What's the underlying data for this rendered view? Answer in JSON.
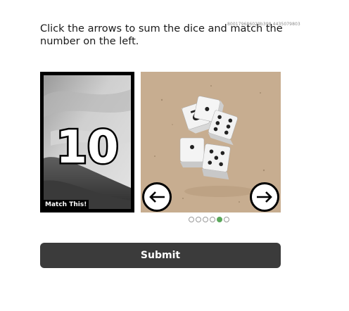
{
  "session_id": "800179686029b398.4435079803",
  "instructions": "Click the arrows to sum the dice and match the number on the left.",
  "target_card": {
    "number": "10",
    "label": "Match This!"
  },
  "dice_card": {
    "prev_icon": "arrow-left-icon",
    "next_icon": "arrow-right-icon"
  },
  "pager": {
    "total": 6,
    "active_index": 4,
    "active_color": "#5ba85b"
  },
  "submit_label": "Submit"
}
